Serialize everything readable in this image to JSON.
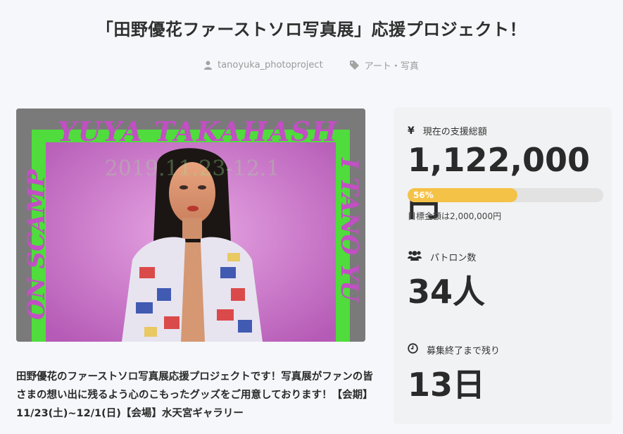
{
  "title": "「田野優花ファーストソロ写真展」応援プロジェクト！",
  "meta": {
    "author": "tanoyuka_photoproject",
    "category": "アート・写真"
  },
  "hero": {
    "banner_top": "YUYA TAKAHASH",
    "banner_left": "ON SCAMP",
    "banner_right": "I TANO YU",
    "overlay_text": "2019.11.23-12.1"
  },
  "description": "田野優花のファーストソロ写真展応援プロジェクトです！写真展がファンの皆さまの想い出に残るよう心のこもったグッズをご用意しております！【会期】11/23(土)~12/1(日)【会場】水天宮ギャラリー",
  "stats": {
    "amount_label": "現在の支援総額",
    "amount_icon": "yen-icon",
    "amount_value": "1,122,000円",
    "progress_percent": 56,
    "progress_label": "56%",
    "goal_text": "目標金額は2,000,000円",
    "patrons_label": "パトロン数",
    "patrons_icon": "users-icon",
    "patrons_value": "34人",
    "remaining_label": "募集終了まで残り",
    "remaining_icon": "clock-icon",
    "remaining_value": "13日"
  },
  "colors": {
    "progress": "#f5c248",
    "track": "#e2e2e2",
    "banner_purple": "#c24fc4",
    "banner_green": "#4de03a"
  }
}
